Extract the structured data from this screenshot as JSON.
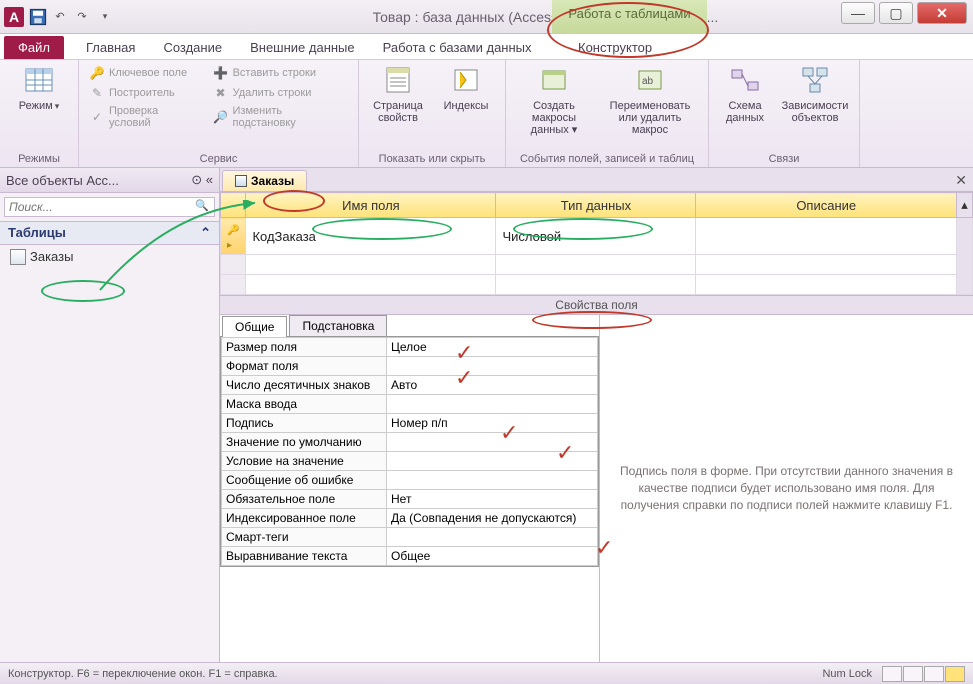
{
  "titlebar": {
    "app_letter": "A",
    "title": "Товар : база данных (Access 2007 - 2010) - Microsof...",
    "contextual_title": "Работа с таблицами"
  },
  "tabs": {
    "file": "Файл",
    "home": "Главная",
    "create": "Создание",
    "external": "Внешние данные",
    "dbtools": "Работа с базами данных",
    "design": "Конструктор"
  },
  "ribbon": {
    "modes": {
      "view": "Режим",
      "group": "Режимы"
    },
    "tools": {
      "pk": "Ключевое поле",
      "builder": "Построитель",
      "validate": "Проверка условий",
      "insert_rows": "Вставить строки",
      "delete_rows": "Удалить строки",
      "modify_lookup": "Изменить подстановку",
      "group": "Сервис"
    },
    "showhide": {
      "propsheet": "Страница свойств",
      "indexes": "Индексы",
      "group": "Показать или скрыть"
    },
    "events": {
      "create_macros": "Создать макросы данных ▾",
      "rename_delete": "Переименовать или удалить макрос",
      "group": "События полей, записей и таблиц"
    },
    "relations": {
      "schema": "Схема данных",
      "deps": "Зависимости объектов",
      "group": "Связи"
    }
  },
  "nav": {
    "header": "Все объекты Acc...",
    "search_placeholder": "Поиск...",
    "category": "Таблицы",
    "item_orders": "Заказы"
  },
  "designview": {
    "tab_name": "Заказы",
    "col_fieldname": "Имя поля",
    "col_datatype": "Тип данных",
    "col_desc": "Описание",
    "row1_name": "КодЗаказа",
    "row1_type": "Числовой"
  },
  "props": {
    "divider": "Свойства поля",
    "tab_general": "Общие",
    "tab_lookup": "Подстановка",
    "rows": [
      {
        "label": "Размер поля",
        "value": "Целое"
      },
      {
        "label": "Формат поля",
        "value": ""
      },
      {
        "label": "Число десятичных знаков",
        "value": "Авто"
      },
      {
        "label": "Маска ввода",
        "value": ""
      },
      {
        "label": "Подпись",
        "value": "Номер п/п"
      },
      {
        "label": "Значение по умолчанию",
        "value": ""
      },
      {
        "label": "Условие на значение",
        "value": ""
      },
      {
        "label": "Сообщение об ошибке",
        "value": ""
      },
      {
        "label": "Обязательное поле",
        "value": "Нет"
      },
      {
        "label": "Индексированное поле",
        "value": "Да (Совпадения не допускаются)"
      },
      {
        "label": "Смарт-теги",
        "value": ""
      },
      {
        "label": "Выравнивание текста",
        "value": "Общее"
      }
    ],
    "helptext": "Подпись поля в форме. При отсутствии данного значения в качестве подписи будет использовано имя поля. Для получения справки по подписи полей нажмите клавишу F1."
  },
  "statusbar": {
    "left": "Конструктор.  F6 = переключение окон.  F1 = справка.",
    "numlock": "Num Lock"
  }
}
